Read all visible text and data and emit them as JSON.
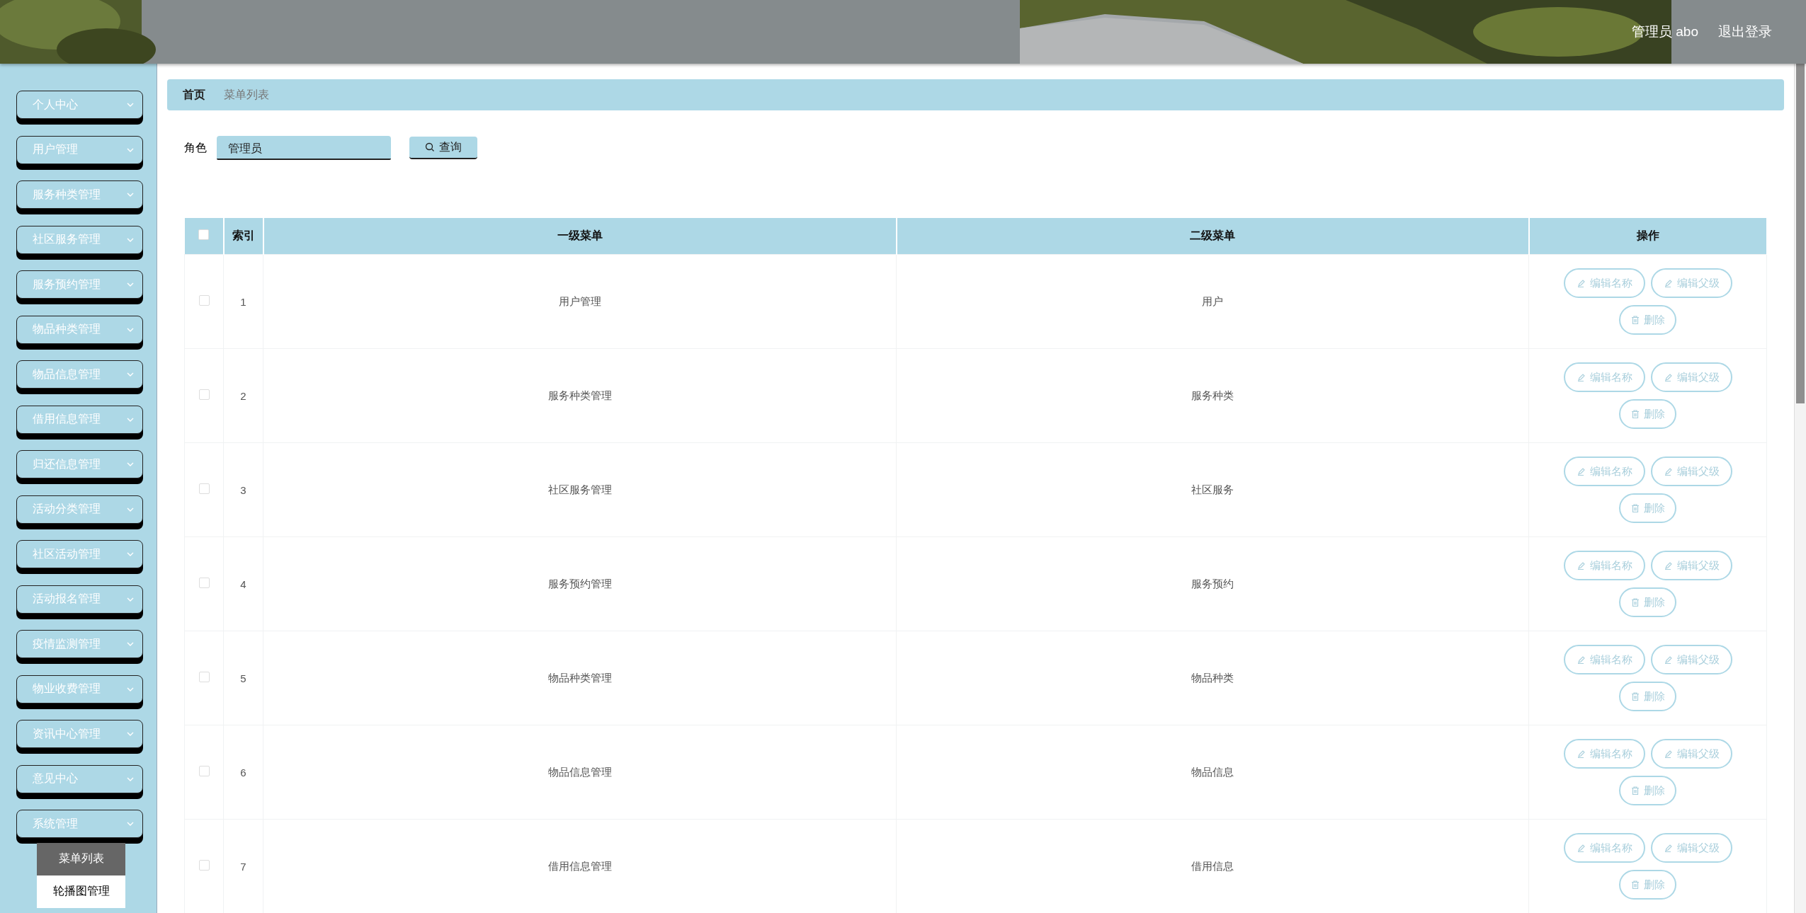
{
  "header": {
    "user": "管理员 abo",
    "logout": "退出登录"
  },
  "sidebar": {
    "items": [
      {
        "label": "个人中心"
      },
      {
        "label": "用户管理"
      },
      {
        "label": "服务种类管理"
      },
      {
        "label": "社区服务管理"
      },
      {
        "label": "服务预约管理"
      },
      {
        "label": "物品种类管理"
      },
      {
        "label": "物品信息管理"
      },
      {
        "label": "借用信息管理"
      },
      {
        "label": "归还信息管理"
      },
      {
        "label": "活动分类管理"
      },
      {
        "label": "社区活动管理"
      },
      {
        "label": "活动报名管理"
      },
      {
        "label": "疫情监测管理"
      },
      {
        "label": "物业收费管理"
      },
      {
        "label": "资讯中心管理"
      },
      {
        "label": "意见中心"
      },
      {
        "label": "系统管理",
        "children": [
          {
            "label": "菜单列表",
            "selected": true
          },
          {
            "label": "轮播图管理",
            "selected": false
          }
        ]
      }
    ]
  },
  "breadcrumb": [
    {
      "label": "首页",
      "kind": "home"
    },
    {
      "label": "菜单列表",
      "kind": "current"
    }
  ],
  "search": {
    "label": "角色",
    "value": "管理员",
    "button": "查询"
  },
  "table": {
    "select_all": {
      "checked": false
    },
    "columns": [
      "索引",
      "一级菜单",
      "二级菜单",
      "操作"
    ],
    "rows": [
      {
        "checked": false,
        "cells": [
          "1",
          "用户管理",
          "用户"
        ],
        "actions": [
          {
            "label": "编辑名称",
            "kind": "edit"
          },
          {
            "label": "编辑父级",
            "kind": "edit"
          },
          {
            "label": "删除",
            "kind": "delete"
          }
        ]
      },
      {
        "checked": false,
        "cells": [
          "2",
          "服务种类管理",
          "服务种类"
        ],
        "actions": [
          {
            "label": "编辑名称",
            "kind": "edit"
          },
          {
            "label": "编辑父级",
            "kind": "edit"
          },
          {
            "label": "删除",
            "kind": "delete"
          }
        ]
      },
      {
        "checked": false,
        "cells": [
          "3",
          "社区服务管理",
          "社区服务"
        ],
        "actions": [
          {
            "label": "编辑名称",
            "kind": "edit"
          },
          {
            "label": "编辑父级",
            "kind": "edit"
          },
          {
            "label": "删除",
            "kind": "delete"
          }
        ]
      },
      {
        "checked": false,
        "cells": [
          "4",
          "服务预约管理",
          "服务预约"
        ],
        "actions": [
          {
            "label": "编辑名称",
            "kind": "edit"
          },
          {
            "label": "编辑父级",
            "kind": "edit"
          },
          {
            "label": "删除",
            "kind": "delete"
          }
        ]
      },
      {
        "checked": false,
        "cells": [
          "5",
          "物品种类管理",
          "物品种类"
        ],
        "actions": [
          {
            "label": "编辑名称",
            "kind": "edit"
          },
          {
            "label": "编辑父级",
            "kind": "edit"
          },
          {
            "label": "删除",
            "kind": "delete"
          }
        ]
      },
      {
        "checked": false,
        "cells": [
          "6",
          "物品信息管理",
          "物品信息"
        ],
        "actions": [
          {
            "label": "编辑名称",
            "kind": "edit"
          },
          {
            "label": "编辑父级",
            "kind": "edit"
          },
          {
            "label": "删除",
            "kind": "delete"
          }
        ]
      },
      {
        "checked": false,
        "cells": [
          "7",
          "借用信息管理",
          "借用信息"
        ],
        "actions": [
          {
            "label": "编辑名称",
            "kind": "edit"
          },
          {
            "label": "编辑父级",
            "kind": "edit"
          },
          {
            "label": "删除",
            "kind": "delete"
          }
        ]
      }
    ]
  }
}
